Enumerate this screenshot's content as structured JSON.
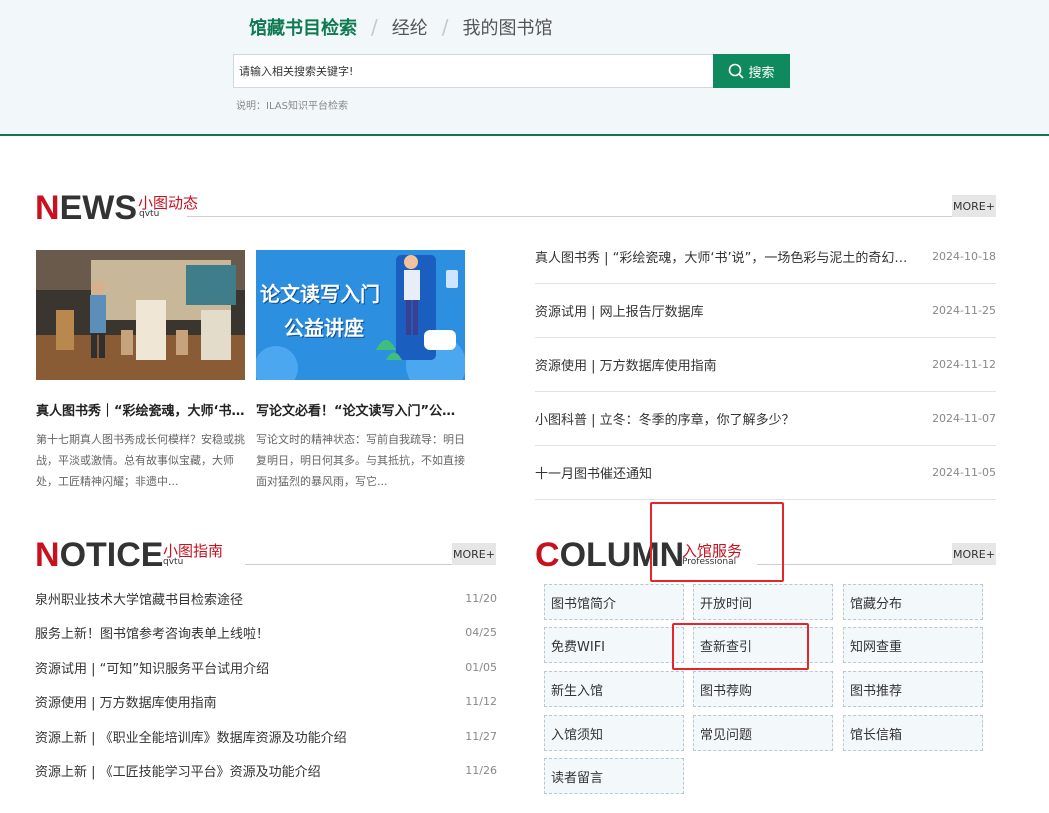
{
  "search": {
    "tabs": [
      {
        "label": "馆藏书目检索",
        "active": true
      },
      {
        "label": "经纶",
        "active": false
      },
      {
        "label": "我的图书馆",
        "active": false
      }
    ],
    "input_value": "请输入相关搜索关键字!",
    "button_label": "搜索",
    "note": "说明：ILAS知识平台检索"
  },
  "news": {
    "heading_first": "N",
    "heading_rest": "EWS",
    "heading_cn": "小图动态",
    "heading_en": "qvtu",
    "more": "MORE+",
    "cards": [
      {
        "title": "真人图书秀｜“彩绘瓷魂，大师‘书’说”，一场色彩与泥土的奇幻之旅",
        "desc": "第十七期真人图书秀成长何模样？安稳或挑战，平淡或激情。总有故事似宝藏，大师处，工匠精神闪耀；非遗中..."
      },
      {
        "title": "写论文必看！“论文读写入门”公益讲座",
        "banner_line1": "论文读写入门",
        "banner_line2": "公益讲座",
        "desc": "写论文时的精神状态：写前自我疏导：明日复明日，明日何其多。与其抵抗，不如直接面对猛烈的暴风雨，写它..."
      }
    ],
    "items": [
      {
        "title": "真人图书秀 | “彩绘瓷魂，大师‘书’说”，一场色彩与泥土的奇幻之旅",
        "date": "2024-10-18"
      },
      {
        "title": "资源试用 | 网上报告厅数据库",
        "date": "2024-11-25"
      },
      {
        "title": "资源使用 | 万方数据库使用指南",
        "date": "2024-11-12"
      },
      {
        "title": "小图科普 | 立冬：冬季的序章，你了解多少？",
        "date": "2024-11-07"
      },
      {
        "title": "十一月图书催还通知",
        "date": "2024-11-05"
      }
    ]
  },
  "notice": {
    "heading_first": "N",
    "heading_rest": "OTICE",
    "heading_cn": "小图指南",
    "heading_en": "qvtu",
    "more": "MORE+",
    "items": [
      {
        "title": "泉州职业技术大学馆藏书目检索途径",
        "date": "11/20"
      },
      {
        "title": "服务上新！图书馆参考咨询表单上线啦！",
        "date": "04/25"
      },
      {
        "title": "资源试用 | “可知”知识服务平台试用介绍",
        "date": "01/05"
      },
      {
        "title": "资源使用 | 万方数据库使用指南",
        "date": "11/12"
      },
      {
        "title": "资源上新 | 《职业全能培训库》数据库资源及功能介绍",
        "date": "11/27"
      },
      {
        "title": "资源上新 | 《工匠技能学习平台》资源及功能介绍",
        "date": "11/26"
      }
    ]
  },
  "column": {
    "heading_first": "C",
    "heading_rest": "OLUMN",
    "heading_cn": "入馆服务",
    "heading_en": "Professional",
    "more": "MORE+",
    "items": [
      "图书馆简介",
      "开放时间",
      "馆藏分布",
      "免费WIFI",
      "查新查引",
      "知网查重",
      "新生入馆",
      "图书荐购",
      "图书推荐",
      "入馆须知",
      "常见问题",
      "馆长信箱",
      "读者留言"
    ]
  },
  "colors": {
    "brand_green": "#0f8a5f",
    "accent_red": "#c8101e",
    "highlight_red": "#e8242a"
  }
}
